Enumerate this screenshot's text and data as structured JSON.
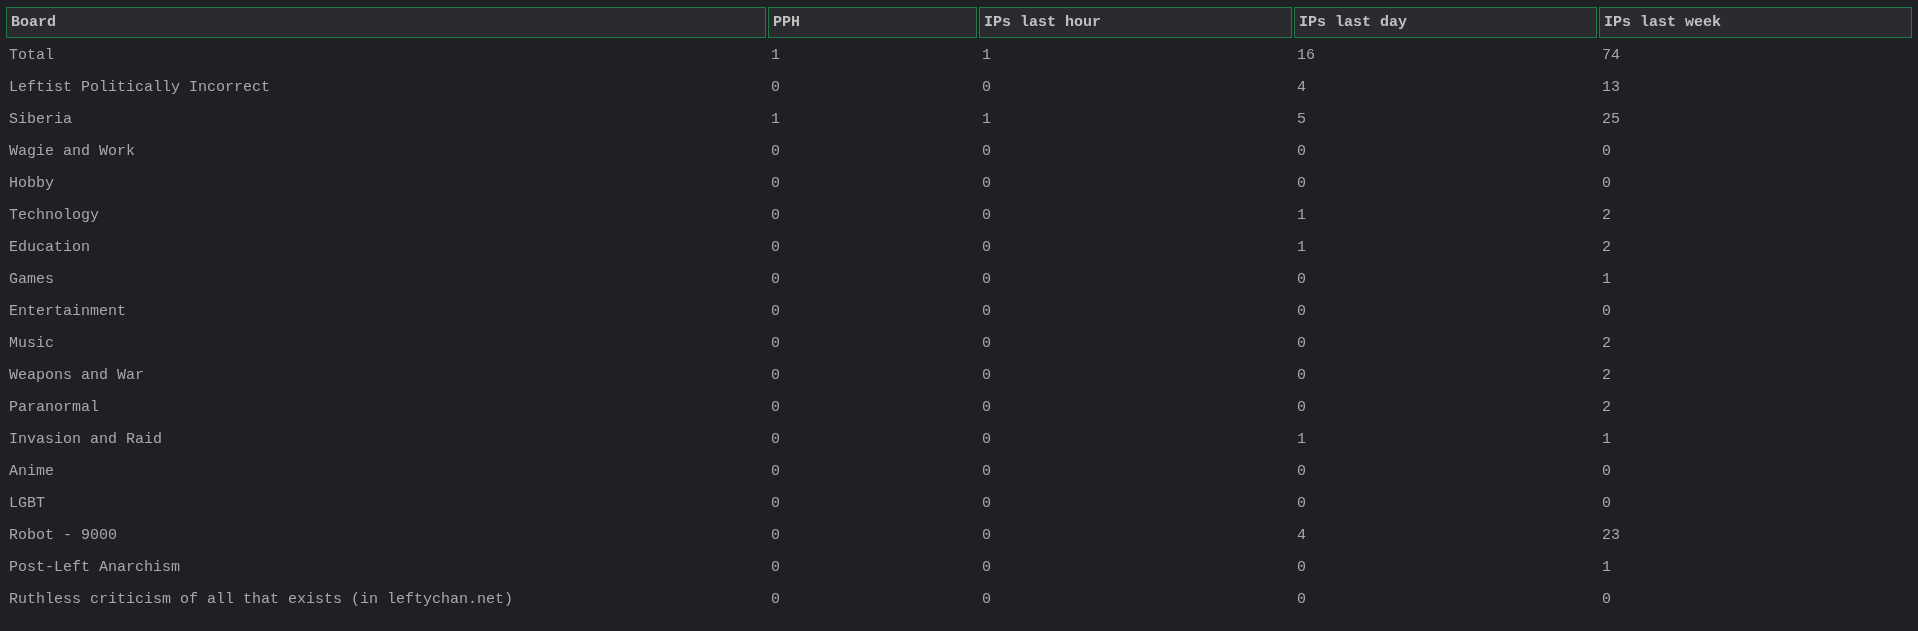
{
  "table": {
    "columns": [
      "Board",
      "PPH",
      "IPs last hour",
      "IPs last day",
      "IPs last week"
    ],
    "rows": [
      [
        "Total",
        "1",
        "1",
        "16",
        "74"
      ],
      [
        "Leftist Politically Incorrect",
        "0",
        "0",
        "4",
        "13"
      ],
      [
        "Siberia",
        "1",
        "1",
        "5",
        "25"
      ],
      [
        "Wagie and Work",
        "0",
        "0",
        "0",
        "0"
      ],
      [
        "Hobby",
        "0",
        "0",
        "0",
        "0"
      ],
      [
        "Technology",
        "0",
        "0",
        "1",
        "2"
      ],
      [
        "Education",
        "0",
        "0",
        "1",
        "2"
      ],
      [
        "Games",
        "0",
        "0",
        "0",
        "1"
      ],
      [
        "Entertainment",
        "0",
        "0",
        "0",
        "0"
      ],
      [
        "Music",
        "0",
        "0",
        "0",
        "2"
      ],
      [
        "Weapons and War",
        "0",
        "0",
        "0",
        "2"
      ],
      [
        "Paranormal",
        "0",
        "0",
        "0",
        "2"
      ],
      [
        "Invasion and Raid",
        "0",
        "0",
        "1",
        "1"
      ],
      [
        "Anime",
        "0",
        "0",
        "0",
        "0"
      ],
      [
        "LGBT",
        "0",
        "0",
        "0",
        "0"
      ],
      [
        "Robot - 9000",
        "0",
        "0",
        "4",
        "23"
      ],
      [
        "Post-Left Anarchism",
        "0",
        "0",
        "0",
        "1"
      ],
      [
        "Ruthless criticism of all that exists (in leftychan.net)",
        "0",
        "0",
        "0",
        "0"
      ]
    ]
  }
}
